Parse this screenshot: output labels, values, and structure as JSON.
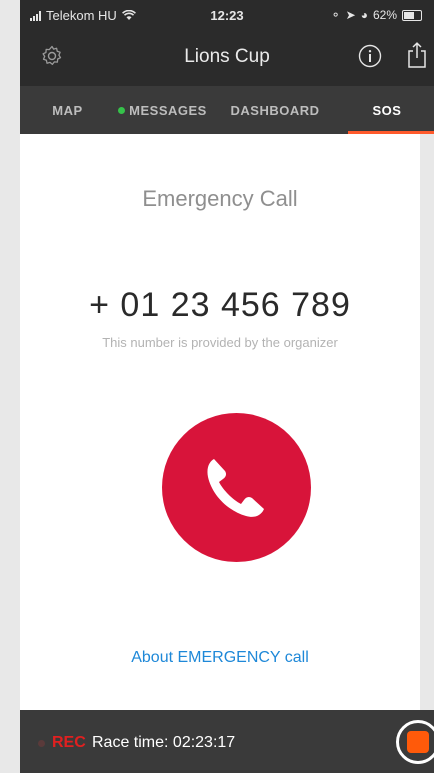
{
  "status_bar": {
    "carrier": "Telekom HU",
    "time": "12:23",
    "battery_percent": "62%"
  },
  "nav": {
    "title": "Lions Cup",
    "settings_icon": "gear-icon",
    "info_icon": "info-icon",
    "share_icon": "share-icon"
  },
  "tabs": [
    {
      "label": "MAP",
      "active": false
    },
    {
      "label": "MESSAGES",
      "active": false,
      "indicator_color": "#35c24a"
    },
    {
      "label": "DASHBOARD",
      "active": false
    },
    {
      "label": "SOS",
      "active": true
    }
  ],
  "main": {
    "heading": "Emergency Call",
    "phone_number": "+ 01 23 456 789",
    "subtext": "This number is provided by the organizer",
    "call_icon": "phone-icon",
    "about_link": "About EMERGENCY call"
  },
  "bottom_bar": {
    "rec_label": "REC",
    "race_time": "Race time: 02:23:17",
    "stop_icon": "stop-icon"
  },
  "colors": {
    "accent": "#ff5a2c",
    "call_red": "#d8143a",
    "link_blue": "#1e88d8",
    "rec_red": "#e02020"
  }
}
